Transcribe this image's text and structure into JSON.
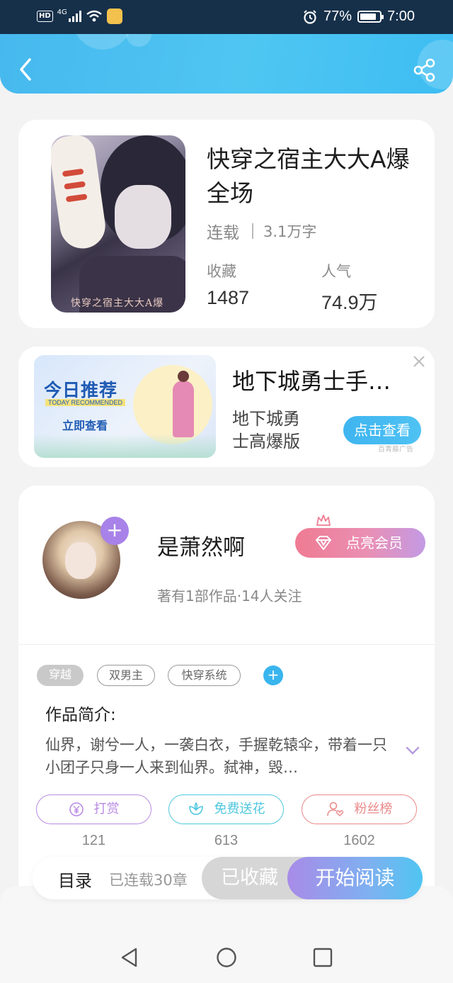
{
  "status_bar": {
    "network": "4G",
    "hd": "HD",
    "battery": "77%",
    "time": "7:00"
  },
  "header": {
    "back_icon": "chevron-left-icon",
    "share_icon": "share-icon"
  },
  "book": {
    "cover_text": "快穿之宿主大大A爆",
    "title": "快穿之宿主大大A爆全场",
    "status": "连载",
    "word_count": "3.1万字",
    "favorites_label": "收藏",
    "favorites_value": "1487",
    "popularity_label": "人气",
    "popularity_value": "74.9万"
  },
  "ad": {
    "banner_title": "今日推荐",
    "banner_subtitle": "TODAY RECOMMENDED",
    "banner_cta": "立即查看",
    "title": "地下城勇士手…",
    "subtitle": "地下城勇士高爆版",
    "button": "点击查看",
    "source": "百青藤广告"
  },
  "author": {
    "name": "是萧然啊",
    "meta": "著有1部作品·14人关注",
    "vip_button": "点亮会员"
  },
  "tags": [
    "穿越",
    "双男主",
    "快穿系统"
  ],
  "intro": {
    "title": "作品简介:",
    "text": "仙界，谢兮一人，一袭白衣，手握乾辕伞，带着一只小团子只身一人来到仙界。弑神，毁…"
  },
  "actions": [
    {
      "label": "打赏",
      "count": "121",
      "color": "#b98be3"
    },
    {
      "label": "免费送花",
      "count": "613",
      "color": "#4fc7de"
    },
    {
      "label": "粉丝榜",
      "count": "1602",
      "color": "#ea8a8a"
    }
  ],
  "bottom_bar": {
    "toc": "目录",
    "chapters": "已连载30章",
    "favorited": "已收藏",
    "start_reading": "开始阅读"
  },
  "colors": {
    "header": "#46b8ee",
    "accent_blue": "#39b5ee",
    "accent_purple": "#a882e8",
    "vip_pink": "#ef7b92"
  }
}
